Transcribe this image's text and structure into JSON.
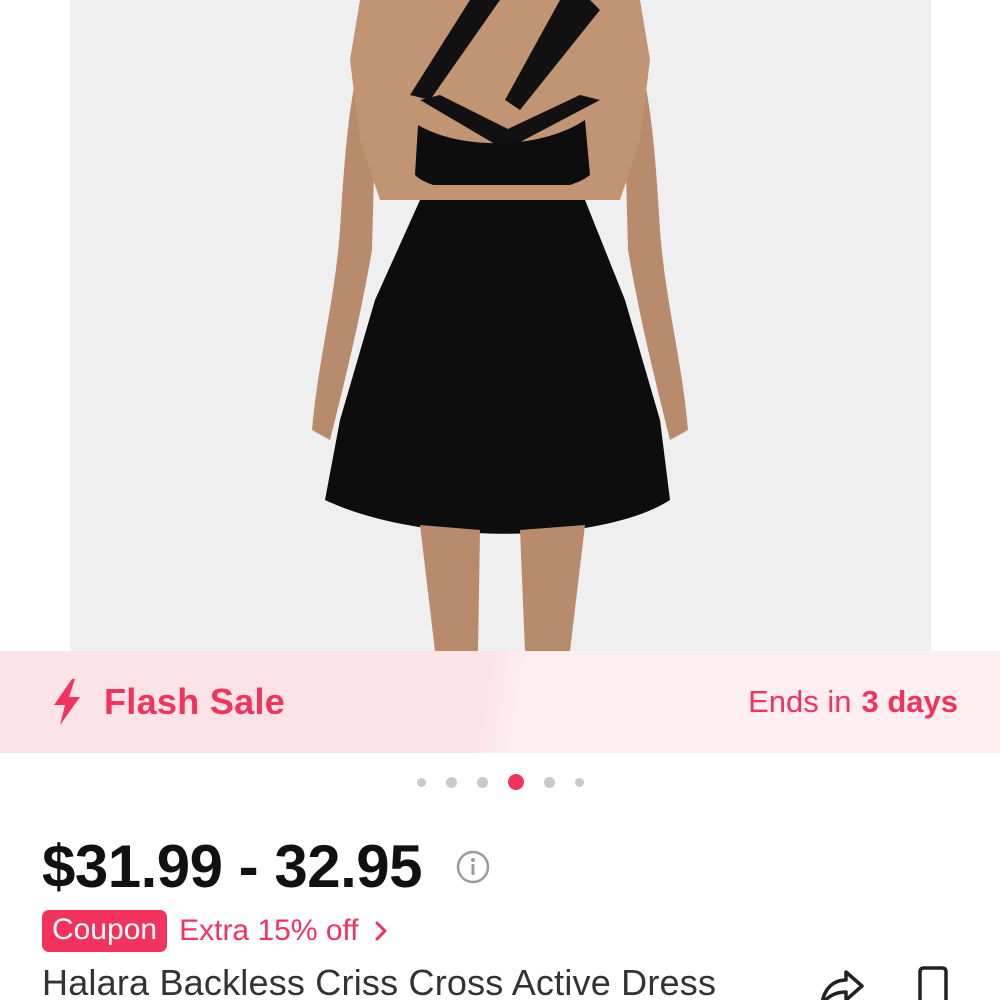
{
  "product": {
    "flash_sale": {
      "label": "Flash Sale",
      "ends_prefix": "Ends in",
      "ends_value": "3 days"
    },
    "carousel": {
      "total": 6,
      "active_index": 3
    },
    "price": "$31.99 - 32.95",
    "coupon": {
      "badge": "Coupon",
      "text": "Extra 15% off"
    },
    "title": "Halara Backless Criss Cross Active Dress"
  },
  "icons": {
    "flash": "lightning-bolt-icon",
    "info": "info-circle-icon",
    "chevron": "chevron-right-icon",
    "share": "share-icon",
    "bookmark": "bookmark-icon"
  },
  "colors": {
    "accent": "#f2335d",
    "flash_bg": "#fbe3e8",
    "image_bg": "#efefef"
  }
}
